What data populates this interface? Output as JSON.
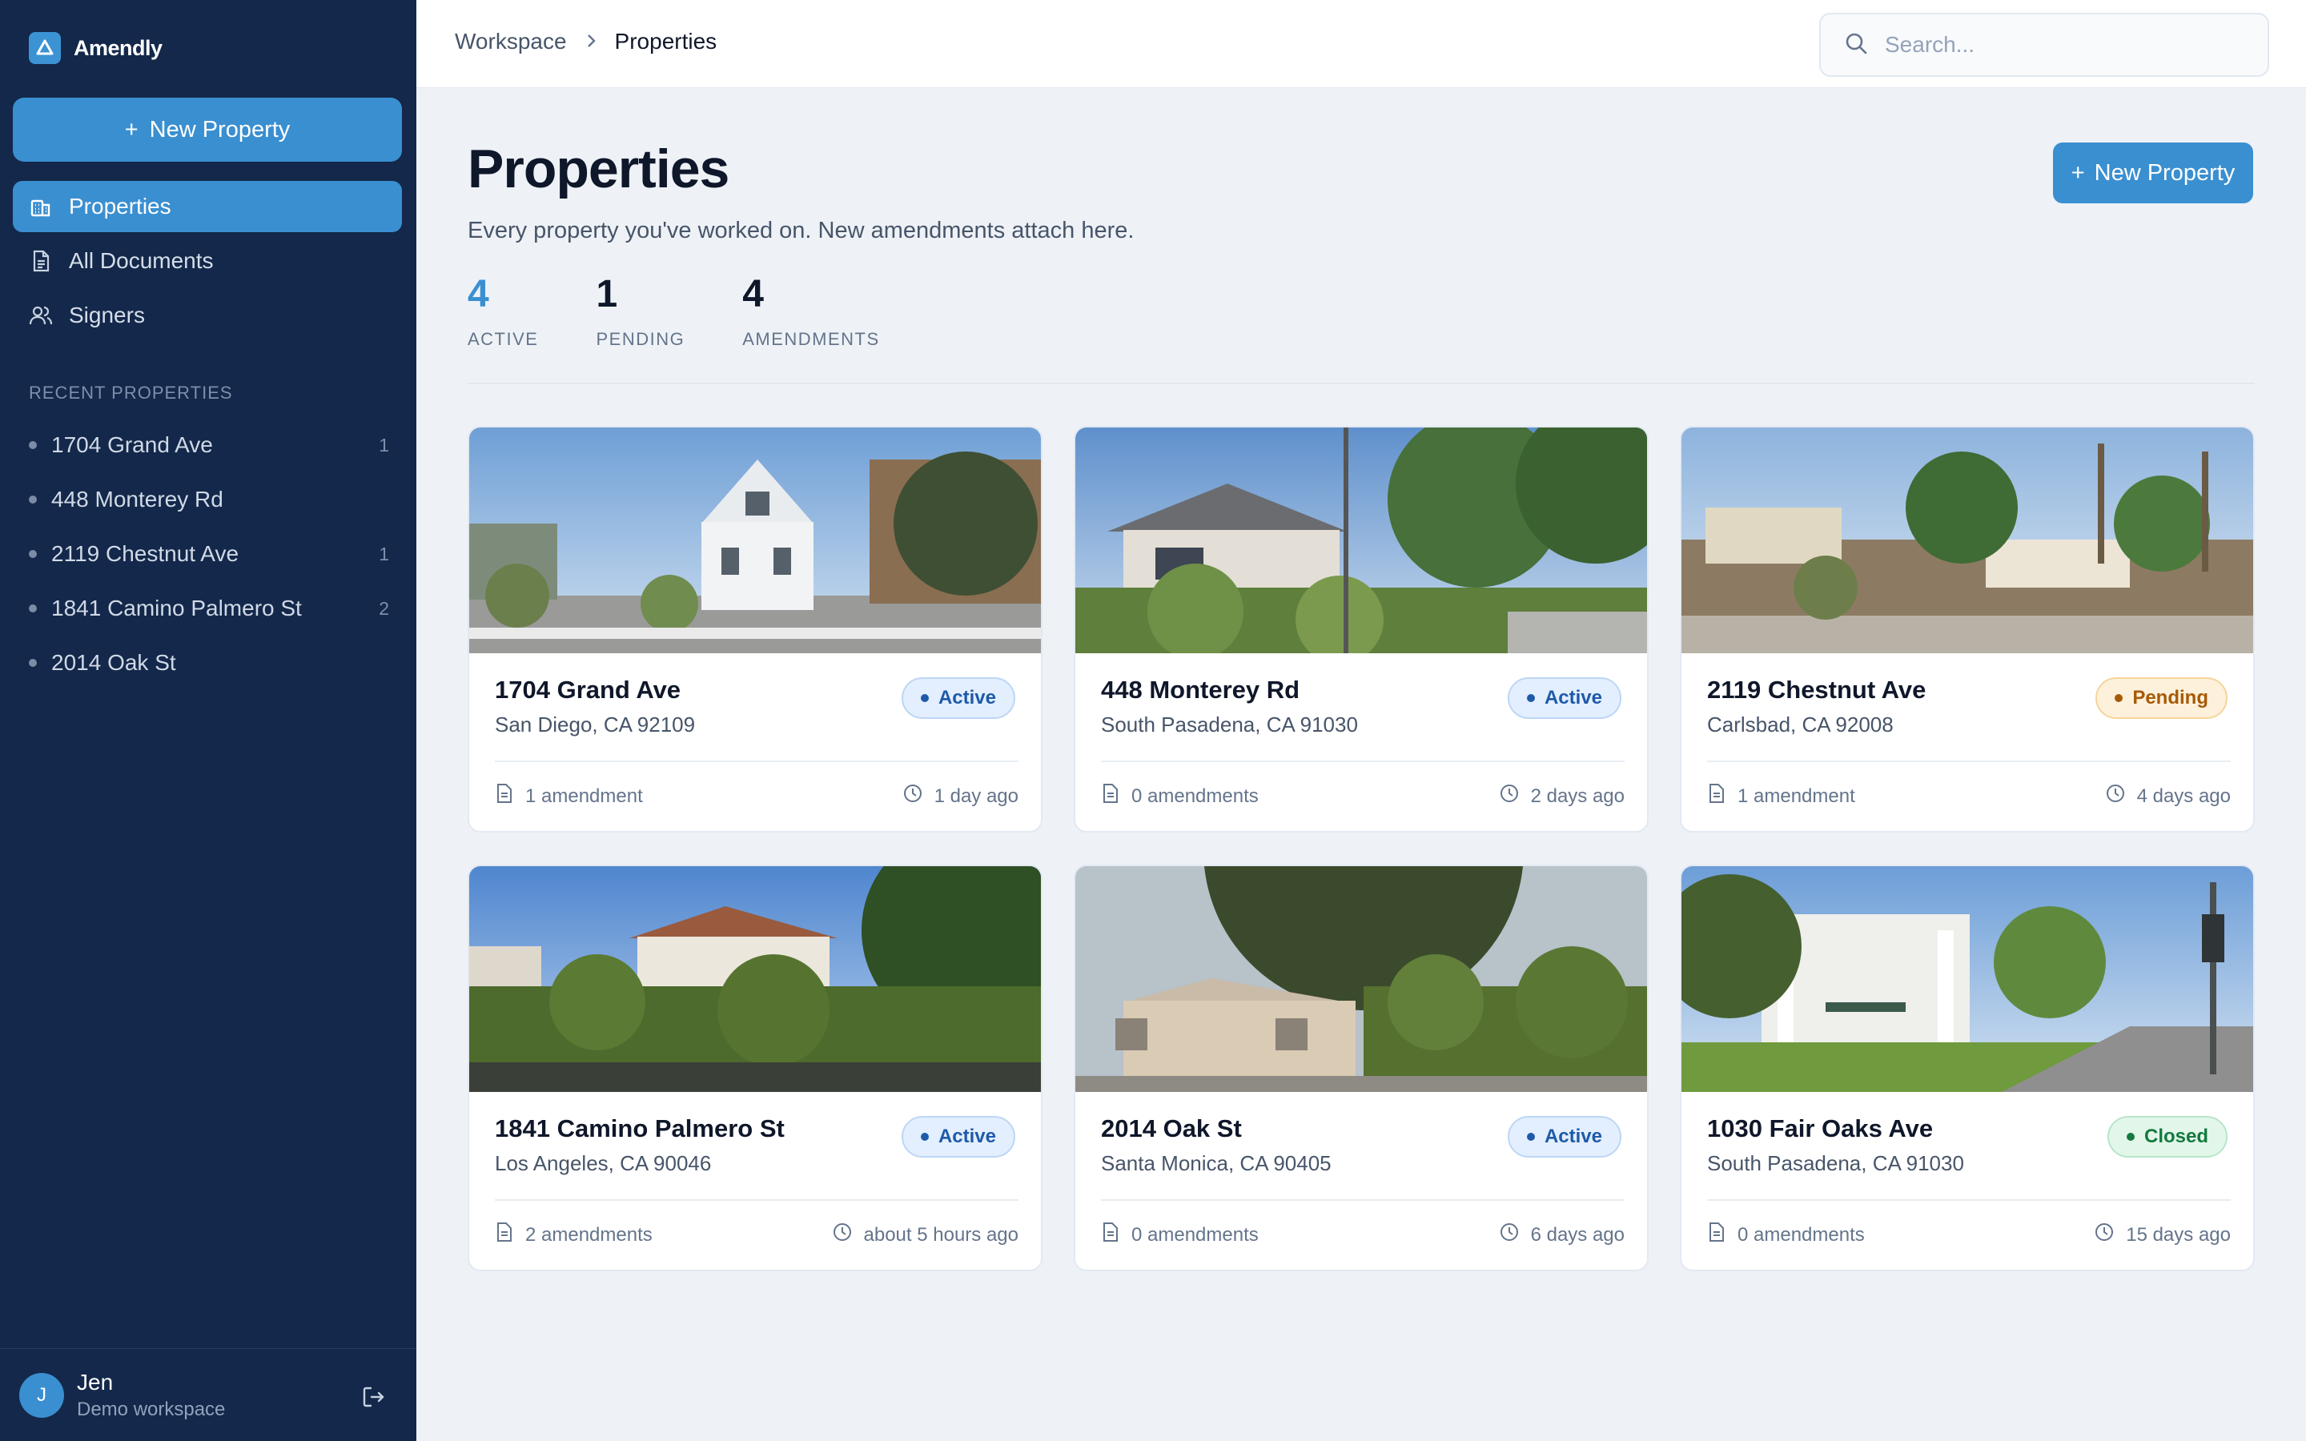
{
  "app": {
    "name": "Amendly"
  },
  "sidebar": {
    "new_button_label": "New Property",
    "nav": [
      {
        "label": "Properties",
        "icon": "building-icon",
        "active": true
      },
      {
        "label": "All Documents",
        "icon": "document-icon",
        "active": false
      },
      {
        "label": "Signers",
        "icon": "users-icon",
        "active": false
      }
    ],
    "recent_heading": "RECENT PROPERTIES",
    "recent": [
      {
        "label": "1704 Grand Ave",
        "count": "1"
      },
      {
        "label": "448 Monterey Rd",
        "count": ""
      },
      {
        "label": "2119 Chestnut Ave",
        "count": "1"
      },
      {
        "label": "1841 Camino Palmero St",
        "count": "2"
      },
      {
        "label": "2014 Oak St",
        "count": ""
      }
    ],
    "user": {
      "initial": "J",
      "name": "Jen",
      "workspace": "Demo workspace"
    }
  },
  "topbar": {
    "breadcrumb": [
      "Workspace",
      "Properties"
    ],
    "search_placeholder": "Search..."
  },
  "main": {
    "title": "Properties",
    "subtitle": "Every property you've worked on. New amendments attach here.",
    "new_button_label": "New Property",
    "stats": [
      {
        "value": "4",
        "label": "ACTIVE"
      },
      {
        "value": "1",
        "label": "PENDING"
      },
      {
        "value": "4",
        "label": "AMENDMENTS"
      }
    ],
    "cards": [
      {
        "name": "1704 Grand Ave",
        "address": "San Diego, CA 92109",
        "status": "Active",
        "amendments": "1 amendment",
        "updated": "1 day ago"
      },
      {
        "name": "448 Monterey Rd",
        "address": "South Pasadena, CA 91030",
        "status": "Active",
        "amendments": "0 amendments",
        "updated": "2 days ago"
      },
      {
        "name": "2119 Chestnut Ave",
        "address": "Carlsbad, CA 92008",
        "status": "Pending",
        "amendments": "1 amendment",
        "updated": "4 days ago"
      },
      {
        "name": "1841 Camino Palmero St",
        "address": "Los Angeles, CA 90046",
        "status": "Active",
        "amendments": "2 amendments",
        "updated": "about 5 hours ago"
      },
      {
        "name": "2014 Oak St",
        "address": "Santa Monica, CA 90405",
        "status": "Active",
        "amendments": "0 amendments",
        "updated": "6 days ago"
      },
      {
        "name": "1030 Fair Oaks Ave",
        "address": "South Pasadena, CA 91030",
        "status": "Closed",
        "amendments": "0 amendments",
        "updated": "15 days ago"
      }
    ]
  },
  "colors": {
    "sidebar_bg": "#13284a",
    "accent": "#3a8fd0",
    "active_badge": "#1e5aa8",
    "pending_badge": "#a75a06",
    "closed_badge": "#157a3f"
  }
}
